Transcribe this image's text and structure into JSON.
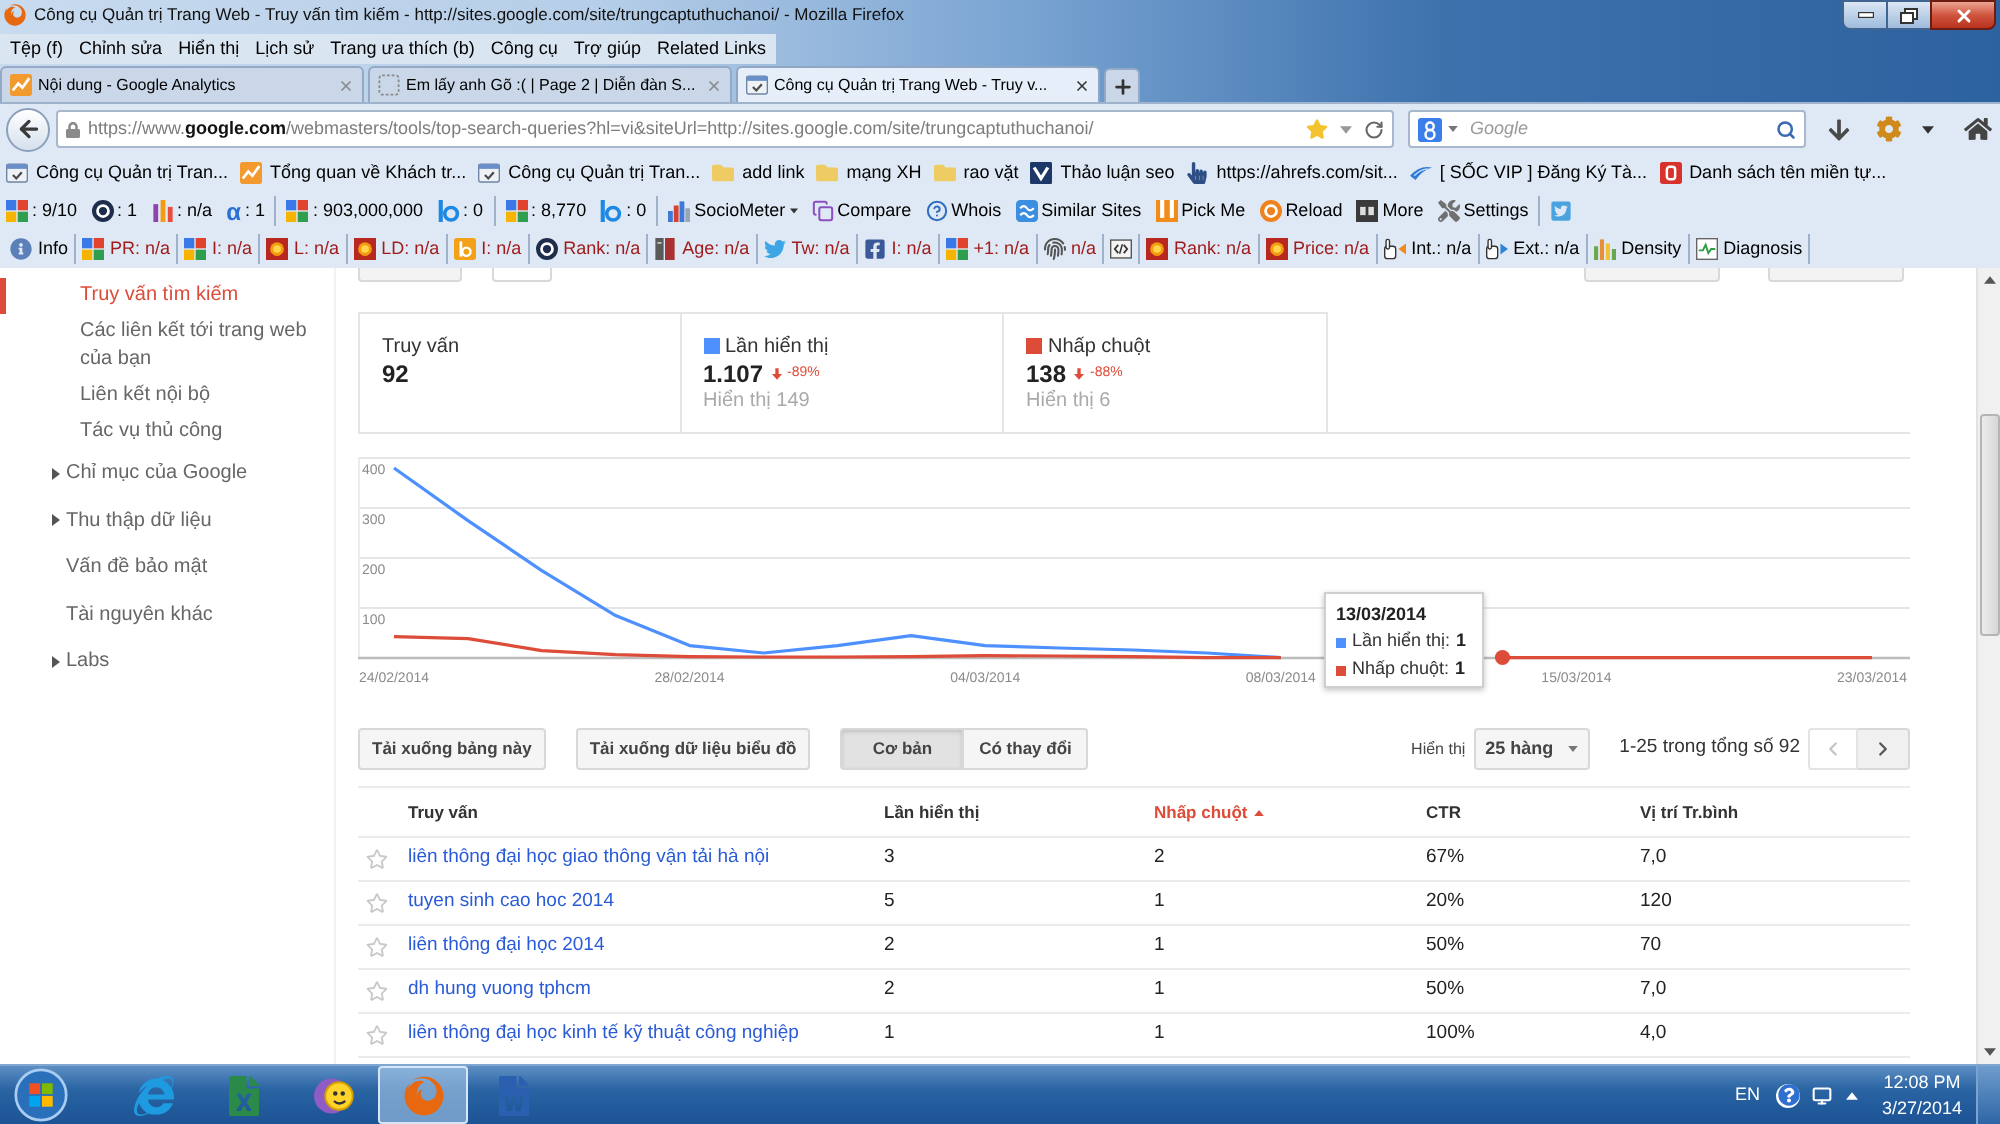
{
  "window": {
    "title": "Công cụ Quản trị Trang Web - Truy vấn tìm kiếm - http://sites.google.com/site/trungcaptuthuchanoi/ - Mozilla Firefox"
  },
  "menu": [
    "Tệp (f)",
    "Chỉnh sửa",
    "Hiển thị",
    "Lịch sử",
    "Trang ưa thích (b)",
    "Công cụ",
    "Trợ giúp",
    "Related Links"
  ],
  "tabs": [
    {
      "label": "Nội dung - Google Analytics",
      "kind": "chart",
      "selected": false
    },
    {
      "label": "Em lấy anh Gõ :( | Page 2 | Diễn đàn S...",
      "kind": "blank",
      "selected": false
    },
    {
      "label": "Công cụ Quản trị Trang Web - Truy v...",
      "kind": "tools",
      "selected": true
    }
  ],
  "address_bar": {
    "url": "https://www.**google.com**/webmasters/tools/top-search-queries?hl=vi&siteUrl=http://sites.google.com/site/trungcaptuthuchanoi/"
  },
  "search_box": {
    "placeholder": "Google"
  },
  "bookmarks": [
    {
      "label": "Công cụ Quản trị Tran...",
      "kind": "tools"
    },
    {
      "label": "Tổng quan về Khách tr...",
      "kind": "chart"
    },
    {
      "label": "Công cụ Quản trị Tran...",
      "kind": "tools"
    },
    {
      "label": "add link",
      "kind": "folder"
    },
    {
      "label": "mạng XH",
      "kind": "folder"
    },
    {
      "label": "rao vặt",
      "kind": "folder"
    },
    {
      "label": "Thảo luận seo",
      "kind": "chevron"
    },
    {
      "label": "https://ahrefs.com/sit...",
      "kind": "hand"
    },
    {
      "label": "[ SỐC VIP ] Đăng Ký Tà...",
      "kind": "swoosh"
    },
    {
      "label": "Danh sách tên miền tự...",
      "kind": "redtile"
    }
  ],
  "seo_toolbar": [
    [
      {
        "kind": "blocks",
        "text": ": 9/10"
      },
      {
        "kind": "badge",
        "text": ": 1"
      },
      {
        "kind": "bars",
        "text": ": n/a"
      },
      {
        "kind": "symbol",
        "symbol": "α",
        "text": ": 1"
      }
    ],
    [
      {
        "kind": "blocks",
        "text": ": 903,000,000"
      },
      {
        "kind": "b",
        "text": ": 0"
      }
    ],
    [
      {
        "kind": "blocks",
        "text": ": 8,770"
      },
      {
        "kind": "b",
        "text": ": 0"
      }
    ],
    [
      {
        "kind": "barchart",
        "text": "SocioMeter",
        "has_menu": true
      },
      {
        "kind": "pages",
        "text": "Compare"
      },
      {
        "kind": "help",
        "text": "Whois"
      },
      {
        "kind": "wave",
        "text": "Similar Sites"
      },
      {
        "kind": "stripes",
        "text": "Pick Me"
      },
      {
        "kind": "target",
        "text": "Reload"
      },
      {
        "kind": "tile",
        "text": "More"
      },
      {
        "kind": "wrench",
        "text": "Settings"
      }
    ],
    [
      {
        "kind": "bird"
      }
    ]
  ],
  "stats_toolbar": [
    {
      "kind": "info",
      "text": "Info",
      "color": "#000000"
    },
    {
      "kind": "blocks",
      "text": "PR: n/a",
      "color": "#a01c1c"
    },
    {
      "kind": "blocks",
      "text": "I: n/a",
      "color": "#a01c1c"
    },
    {
      "kind": "sun",
      "text": "L: n/a",
      "color": "#a01c1c"
    },
    {
      "kind": "sun",
      "text": "LD: n/a",
      "color": "#a01c1c"
    },
    {
      "kind": "btile",
      "text": "I: n/a",
      "color": "#a01c1c"
    },
    {
      "kind": "badge",
      "text": "Rank: n/a",
      "color": "#a01c1c"
    },
    {
      "kind": "book",
      "text": "Age: n/a",
      "color": "#a01c1c"
    },
    {
      "kind": "twitter",
      "text": "Tw: n/a",
      "color": "#a01c1c"
    },
    {
      "kind": "ftile",
      "text": "I: n/a",
      "color": "#a01c1c"
    },
    {
      "kind": "blocks",
      "text": "+1: n/a",
      "color": "#a01c1c"
    },
    {
      "kind": "fingerprint",
      "text": "n/a",
      "color": "#a01c1c"
    },
    {
      "kind": "code"
    },
    {
      "kind": "sun",
      "text": "Rank: n/a",
      "color": "#a01c1c"
    },
    {
      "kind": "sun",
      "text": "Price: n/a",
      "color": "#a01c1c"
    },
    {
      "kind": "hand_in",
      "text": "Int.: n/a",
      "color": "#000000"
    },
    {
      "kind": "hand_out",
      "text": "Ext.: n/a",
      "color": "#000000"
    },
    {
      "kind": "density",
      "text": "Density",
      "color": "#000000"
    },
    {
      "kind": "pulse",
      "text": "Diagnosis",
      "color": "#000000"
    }
  ],
  "sidebar": {
    "subitems": [
      {
        "label": "Truy vấn tìm kiếm",
        "selected": true
      },
      {
        "label": "Các liên kết tới trang web của bạn",
        "selected": false
      },
      {
        "label": "Liên kết nội bộ",
        "selected": false
      },
      {
        "label": "Tác vụ thủ công",
        "selected": false
      }
    ],
    "items": [
      {
        "label": "Chỉ mục của Google",
        "selected": false,
        "expanded": false
      },
      {
        "label": "Thu thập dữ liệu",
        "selected": false,
        "expanded": false
      },
      {
        "label": "Vấn đề bảo mật",
        "selected": false
      },
      {
        "label": "Tài nguyên khác",
        "selected": false
      },
      {
        "label": "Labs",
        "selected": false,
        "expanded": false
      }
    ]
  },
  "stats": [
    {
      "label": "Truy vấn",
      "value": "92"
    },
    {
      "label": "Lần hiển thị",
      "value": "1.107",
      "change": "-89%",
      "note": "Hiển thị 149",
      "color": "#4d90fe"
    },
    {
      "label": "Nhấp chuột",
      "value": "138",
      "change": "-88%",
      "note": "Hiển thị 6",
      "color": "#dd4b39"
    }
  ],
  "chart": {
    "chart_data": {
      "type": "line",
      "categories": [
        "24/02/2014",
        null,
        null,
        null,
        "28/02/2014",
        null,
        null,
        null,
        "04/03/2014",
        null,
        null,
        null,
        "08/03/2014",
        null,
        null,
        null,
        "15/03/2014",
        null,
        null,
        null,
        "23/03/2014"
      ],
      "ylim": [
        0,
        400
      ],
      "yticks": [
        100,
        200,
        300,
        400
      ],
      "grid": true,
      "series": [
        {
          "color": "#4d90fe",
          "values": [
            380,
            275,
            175,
            85,
            25,
            10,
            25,
            45,
            25,
            20,
            16,
            10,
            1,
            null,
            null,
            null,
            null,
            null,
            null,
            null,
            null
          ]
        },
        {
          "color": "#dd4b39",
          "values": [
            43,
            39,
            15,
            7,
            3,
            2,
            2,
            3,
            5,
            4,
            3,
            1,
            1,
            null,
            null,
            1,
            1,
            1,
            1,
            1,
            1
          ]
        }
      ]
    },
    "tooltip": {
      "title": "13/03/2014",
      "rows": [
        {
          "label": "Lần hiển thị:",
          "value": "1",
          "color": "#4d90fe"
        },
        {
          "label": "Nhấp chuột:",
          "value": "1",
          "color": "#dd4b39"
        }
      ]
    }
  },
  "table_controls": {
    "buttons": [
      "Tải xuống bảng này",
      "Tải xuống dữ liệu biểu đồ"
    ],
    "views": [
      {
        "label": "Cơ bản",
        "selected": true
      },
      {
        "label": "Có thay đổi",
        "selected": false
      }
    ],
    "rows_label": "Hiển thị",
    "rows_value": "25 hàng",
    "range": "1-25 trong tổng số 92",
    "prev_disabled": true,
    "next_disabled": false
  },
  "table": {
    "columns": [
      {
        "label": "Truy vấn",
        "sorted": false
      },
      {
        "label": "Lần hiển thị",
        "sorted": false
      },
      {
        "label": "Nhấp chuột",
        "sorted": true
      },
      {
        "label": "CTR",
        "sorted": false
      },
      {
        "label": "Vị trí Tr.bình",
        "sorted": false
      }
    ],
    "rows": [
      {
        "starred": false,
        "cells": [
          "liên thông đại học giao thông vận tải hà nội",
          "3",
          "2",
          "67%",
          "7,0"
        ]
      },
      {
        "starred": false,
        "cells": [
          "tuyen sinh cao hoc 2014",
          "5",
          "1",
          "20%",
          "120"
        ]
      },
      {
        "starred": false,
        "cells": [
          "liên thông đại học 2014",
          "2",
          "1",
          "50%",
          "70"
        ]
      },
      {
        "starred": false,
        "cells": [
          "dh hung vuong tphcm",
          "2",
          "1",
          "50%",
          "7,0"
        ]
      },
      {
        "starred": false,
        "cells": [
          "liên thông đại học kinh tế kỹ thuật công nghiệp",
          "1",
          "1",
          "100%",
          "4,0"
        ]
      }
    ]
  },
  "taskbar": {
    "apps": [
      {
        "kind": "e",
        "active": false
      },
      {
        "kind": "sheet",
        "active": false
      },
      {
        "kind": "smiley",
        "active": false
      },
      {
        "kind": "fox",
        "active": true
      },
      {
        "kind": "doc",
        "active": false
      }
    ],
    "language": "EN",
    "time": "12:08 PM",
    "date": "3/27/2014"
  }
}
